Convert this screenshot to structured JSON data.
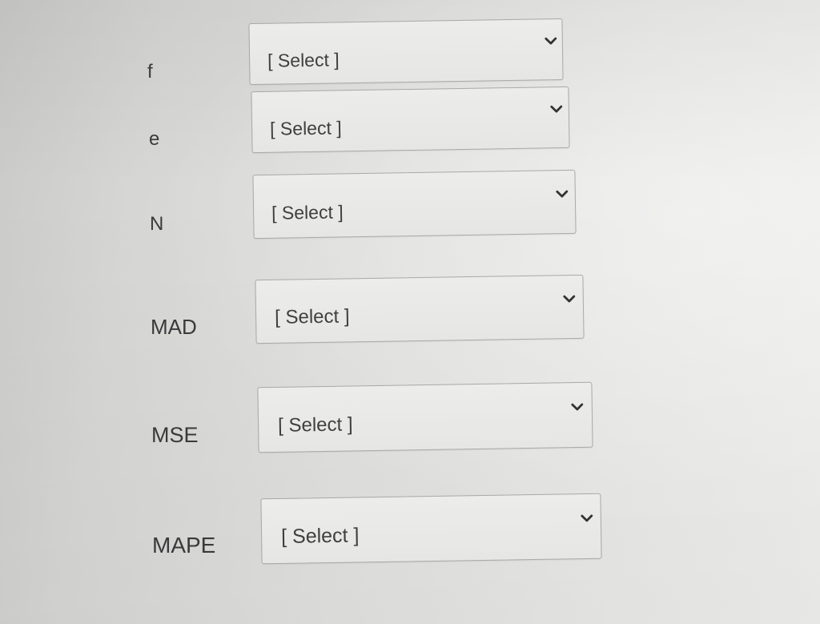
{
  "form": {
    "rows": [
      {
        "label": "f",
        "select": {
          "value": "[ Select ]",
          "icon": "chevron-down-icon"
        }
      },
      {
        "label": "e",
        "select": {
          "value": "[ Select ]",
          "icon": "chevron-down-icon"
        }
      },
      {
        "label": "N",
        "select": {
          "value": "[ Select ]",
          "icon": "chevron-down-icon"
        }
      },
      {
        "label": "MAD",
        "select": {
          "value": "[ Select ]",
          "icon": "chevron-down-icon"
        }
      },
      {
        "label": "MSE",
        "select": {
          "value": "[ Select ]",
          "icon": "chevron-down-icon"
        }
      },
      {
        "label": "MAPE",
        "select": {
          "value": "[ Select ]",
          "icon": "chevron-down-icon"
        }
      }
    ]
  }
}
